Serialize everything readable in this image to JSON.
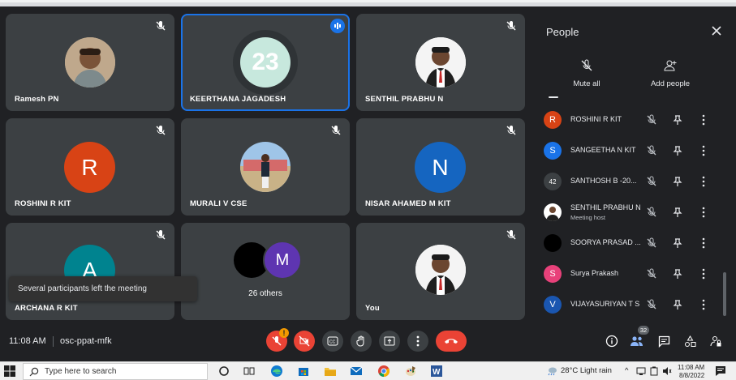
{
  "tiles": [
    {
      "name": "Ramesh PN"
    },
    {
      "name": "KEERTHANA JAGADESH",
      "avatar_text": "23"
    },
    {
      "name": "SENTHIL PRABHU N"
    },
    {
      "name": "ROSHINI R KIT",
      "initial": "R",
      "color": "#d84315"
    },
    {
      "name": "MURALI V CSE"
    },
    {
      "name": "NISAR AHAMED M KIT",
      "initial": "N",
      "color": "#1565c0"
    },
    {
      "name": "ARCHANA R KIT",
      "initial": "A",
      "color": "#00838f"
    },
    {
      "name": "26 others",
      "initial": "M"
    },
    {
      "name": "You"
    }
  ],
  "toast": "Several participants left the meeting",
  "panel": {
    "title": "People",
    "mute_all": "Mute all",
    "add_people": "Add people",
    "participants": [
      {
        "name": "ROSHINI R KIT",
        "initial": "R",
        "color": "#d84315"
      },
      {
        "name": "SANGEETHA N KIT",
        "initial": "S",
        "color": "#1a73e8"
      },
      {
        "name": "SANTHOSH B -20...",
        "initial": "42",
        "color": "#3c4043"
      },
      {
        "name": "SENTHIL PRABHU N",
        "sub": "Meeting host"
      },
      {
        "name": "SOORYA PRASAD ...",
        "color": "#000000"
      },
      {
        "name": "Surya Prakash",
        "initial": "S",
        "color": "#e8417a"
      },
      {
        "name": "VIJAYASURIYAN T S",
        "initial": "V",
        "color": "#1a56b0"
      }
    ]
  },
  "bottom": {
    "time": "11:08 AM",
    "code": "osc-ppat-mfk",
    "warn_badge": "!",
    "people_count": "32"
  },
  "taskbar": {
    "search_placeholder": "Type here to search",
    "weather": "28°C  Light rain",
    "clock_time": "11:08 AM",
    "clock_date": "8/8/2022"
  }
}
